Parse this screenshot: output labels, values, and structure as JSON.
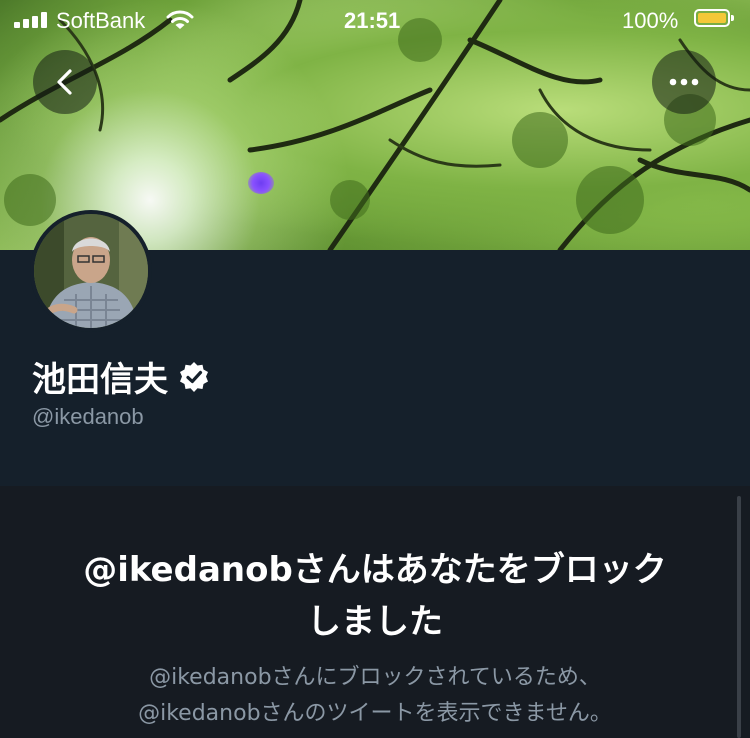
{
  "status_bar": {
    "carrier": "SoftBank",
    "time": "21:51",
    "battery": "100%"
  },
  "header": {
    "back_icon": "chevron-left-icon",
    "more_icon": "more-horizontal-icon"
  },
  "profile": {
    "name": "池田信夫",
    "handle": "@ikedanob",
    "verified": true
  },
  "block_notice": {
    "title_line1": "@ikedanobさんはあなたをブロック",
    "title_line2": "しました",
    "sub_line1": "@ikedanobさんにブロックされているため、",
    "sub_line2": "@ikedanobさんのツイートを表示できません。"
  },
  "colors": {
    "background": "#15202b",
    "text_secondary": "#8b98a5",
    "battery": "#f4c838"
  }
}
